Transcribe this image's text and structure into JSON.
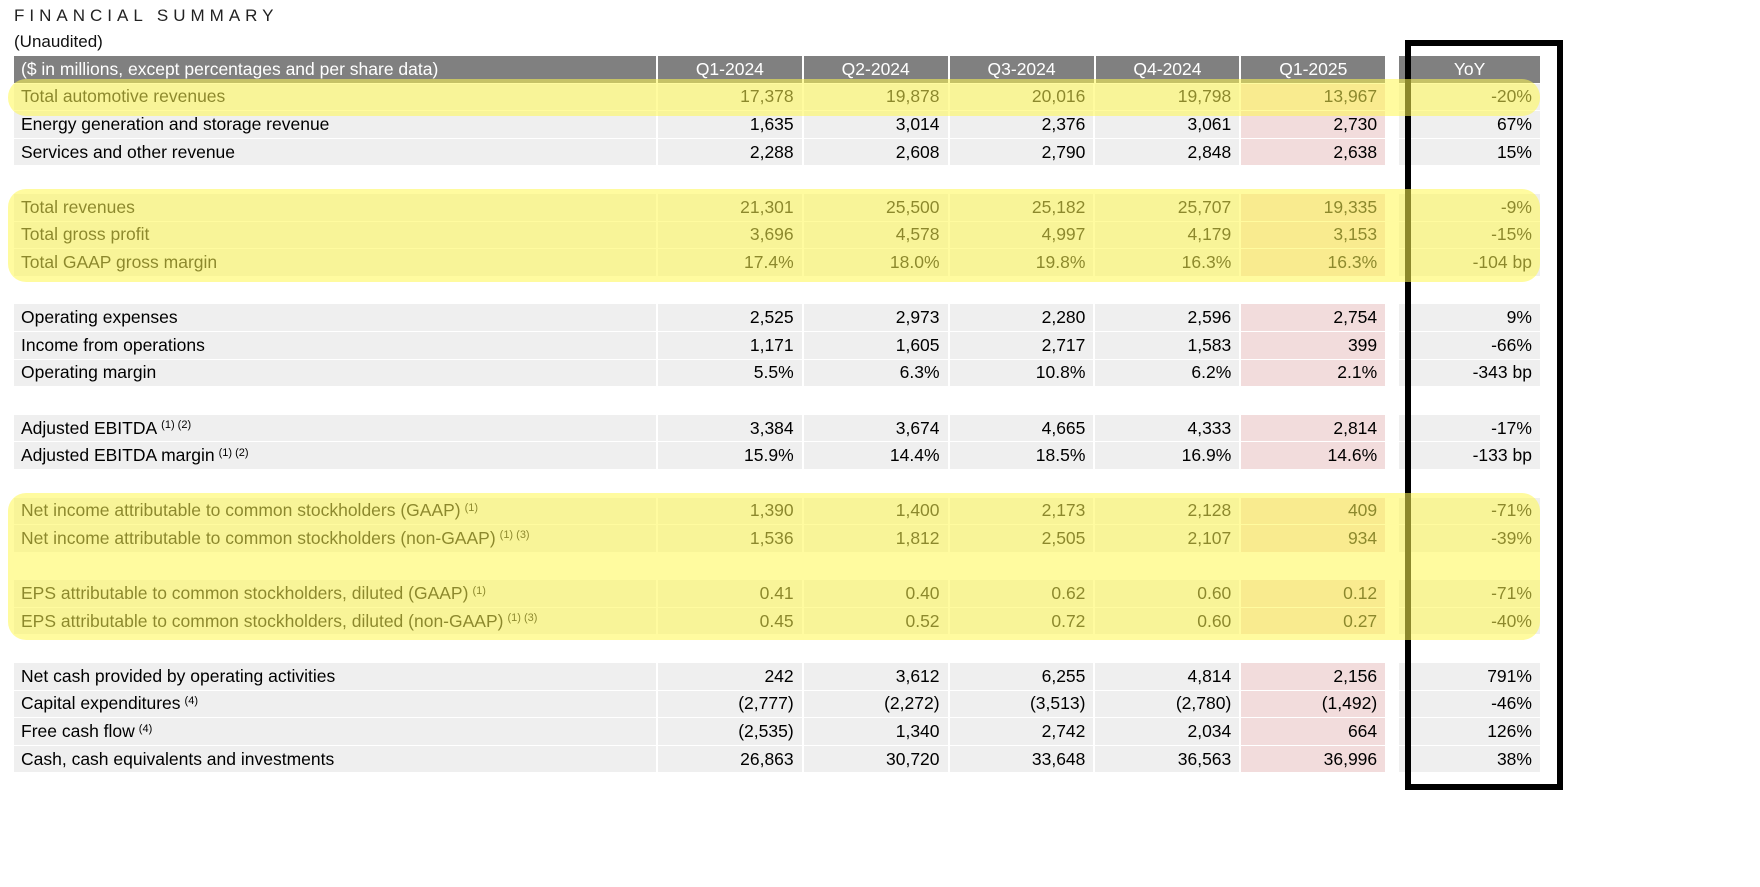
{
  "header": {
    "title": "FINANCIAL SUMMARY",
    "subtitle": "(Unaudited)"
  },
  "columns": {
    "label": "($ in millions, except percentages and per share data)",
    "quarters": [
      "Q1-2024",
      "Q2-2024",
      "Q3-2024",
      "Q4-2024",
      "Q1-2025"
    ],
    "yoy": "YoY"
  },
  "rows": [
    {
      "label": "Total automotive revenues",
      "notes": "",
      "values": [
        "17,378",
        "19,878",
        "20,016",
        "19,798",
        "13,967"
      ],
      "yoy": "-20%",
      "highlight": true
    },
    {
      "label": "Energy generation and storage revenue",
      "notes": "",
      "values": [
        "1,635",
        "3,014",
        "2,376",
        "3,061",
        "2,730"
      ],
      "yoy": "67%",
      "highlight": false
    },
    {
      "label": "Services and other revenue",
      "notes": "",
      "values": [
        "2,288",
        "2,608",
        "2,790",
        "2,848",
        "2,638"
      ],
      "yoy": "15%",
      "highlight": false
    },
    null,
    {
      "label": "Total revenues",
      "notes": "",
      "values": [
        "21,301",
        "25,500",
        "25,182",
        "25,707",
        "19,335"
      ],
      "yoy": "-9%",
      "highlight": true
    },
    {
      "label": "Total gross profit",
      "notes": "",
      "values": [
        "3,696",
        "4,578",
        "4,997",
        "4,179",
        "3,153"
      ],
      "yoy": "-15%",
      "highlight": true
    },
    {
      "label": "Total GAAP gross margin",
      "notes": "",
      "values": [
        "17.4%",
        "18.0%",
        "19.8%",
        "16.3%",
        "16.3%"
      ],
      "yoy": "-104 bp",
      "highlight": true
    },
    null,
    {
      "label": "Operating expenses",
      "notes": "",
      "values": [
        "2,525",
        "2,973",
        "2,280",
        "2,596",
        "2,754"
      ],
      "yoy": "9%",
      "highlight": false
    },
    {
      "label": "Income from operations",
      "notes": "",
      "values": [
        "1,171",
        "1,605",
        "2,717",
        "1,583",
        "399"
      ],
      "yoy": "-66%",
      "highlight": false
    },
    {
      "label": "Operating margin",
      "notes": "",
      "values": [
        "5.5%",
        "6.3%",
        "10.8%",
        "6.2%",
        "2.1%"
      ],
      "yoy": "-343 bp",
      "highlight": false
    },
    null,
    {
      "label": "Adjusted EBITDA",
      "notes": "(1) (2)",
      "values": [
        "3,384",
        "3,674",
        "4,665",
        "4,333",
        "2,814"
      ],
      "yoy": "-17%",
      "highlight": false
    },
    {
      "label": "Adjusted EBITDA margin",
      "notes": "(1) (2)",
      "values": [
        "15.9%",
        "14.4%",
        "18.5%",
        "16.9%",
        "14.6%"
      ],
      "yoy": "-133 bp",
      "highlight": false
    },
    null,
    {
      "label": "Net income attributable to common stockholders (GAAP)",
      "notes": "(1)",
      "values": [
        "1,390",
        "1,400",
        "2,173",
        "2,128",
        "409"
      ],
      "yoy": "-71%",
      "highlight": true
    },
    {
      "label": "Net income attributable to common stockholders (non-GAAP)",
      "notes": "(1) (3)",
      "values": [
        "1,536",
        "1,812",
        "2,505",
        "2,107",
        "934"
      ],
      "yoy": "-39%",
      "highlight": true
    },
    null,
    {
      "label": "EPS attributable to common stockholders, diluted (GAAP)",
      "notes": "(1)",
      "values": [
        "0.41",
        "0.40",
        "0.62",
        "0.60",
        "0.12"
      ],
      "yoy": "-71%",
      "highlight": true
    },
    {
      "label": "EPS attributable to common stockholders, diluted (non-GAAP)",
      "notes": "(1) (3)",
      "values": [
        "0.45",
        "0.52",
        "0.72",
        "0.60",
        "0.27"
      ],
      "yoy": "-40%",
      "highlight": true
    },
    null,
    {
      "label": "Net cash provided by operating activities",
      "notes": "",
      "values": [
        "242",
        "3,612",
        "6,255",
        "4,814",
        "2,156"
      ],
      "yoy": "791%",
      "highlight": false
    },
    {
      "label": "Capital expenditures",
      "notes": "(4)",
      "values": [
        "(2,777)",
        "(2,272)",
        "(3,513)",
        "(2,780)",
        "(1,492)"
      ],
      "yoy": "-46%",
      "highlight": false
    },
    {
      "label": "Free cash flow",
      "notes": "(4)",
      "values": [
        "(2,535)",
        "1,340",
        "2,742",
        "2,034",
        "664"
      ],
      "yoy": "126%",
      "highlight": false
    },
    {
      "label": "Cash, cash equivalents and investments",
      "notes": "",
      "values": [
        "26,863",
        "30,720",
        "33,648",
        "36,563",
        "36,996"
      ],
      "yoy": "38%",
      "highlight": false
    }
  ],
  "colors": {
    "header_bg": "#808080",
    "row_bg": "#efefef",
    "current_quarter_bg": "#f2dcdc",
    "highlight": "#fff850",
    "yoy_box_border": "#000000"
  }
}
